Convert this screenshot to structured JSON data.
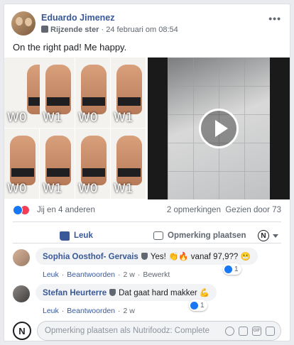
{
  "post": {
    "author": "Eduardo Jimenez",
    "fan_label": "Rijzende ster",
    "meta_separator": " · ",
    "timestamp": "24 februari om 08:54",
    "more": "•••",
    "text": "On the right pad! Me happy."
  },
  "media": {
    "tiles": [
      {
        "label": "W0"
      },
      {
        "label": "W1"
      },
      {
        "label": "W0"
      },
      {
        "label": "W1"
      },
      {
        "label": "W0"
      },
      {
        "label": "W1"
      },
      {
        "label": "W0"
      },
      {
        "label": "W1"
      }
    ]
  },
  "stats": {
    "reactors": "Jij en 4 anderen",
    "comments": "2 opmerkingen",
    "views": "Gezien door 73"
  },
  "actions": {
    "like": "Leuk",
    "comment": "Opmerking plaatsen",
    "page_logo": "N"
  },
  "comments": [
    {
      "name": "Sophia Oosthof- Gervais",
      "text": "Yes! 👏🔥 vanaf 97,9?? 😬",
      "reaction_count": "1",
      "links": [
        "Leuk",
        "Beantwoorden"
      ],
      "time": "2 w",
      "extra": "Bewerkt"
    },
    {
      "name": "Stefan Heurterre",
      "text": "Dat gaat hard makker 💪",
      "reaction_count": "1",
      "links": [
        "Leuk",
        "Beantwoorden"
      ],
      "time": "2 w"
    }
  ],
  "composer": {
    "avatar_letter": "N",
    "placeholder": "Opmerking plaatsen als Nutrifoodz: Complete",
    "icons": [
      "emoji-icon",
      "camera-icon",
      "gif-icon",
      "sticker-icon"
    ]
  },
  "colors": {
    "link": "#385898",
    "like_blue": "#1877f2",
    "heart_red": "#f33e58"
  }
}
